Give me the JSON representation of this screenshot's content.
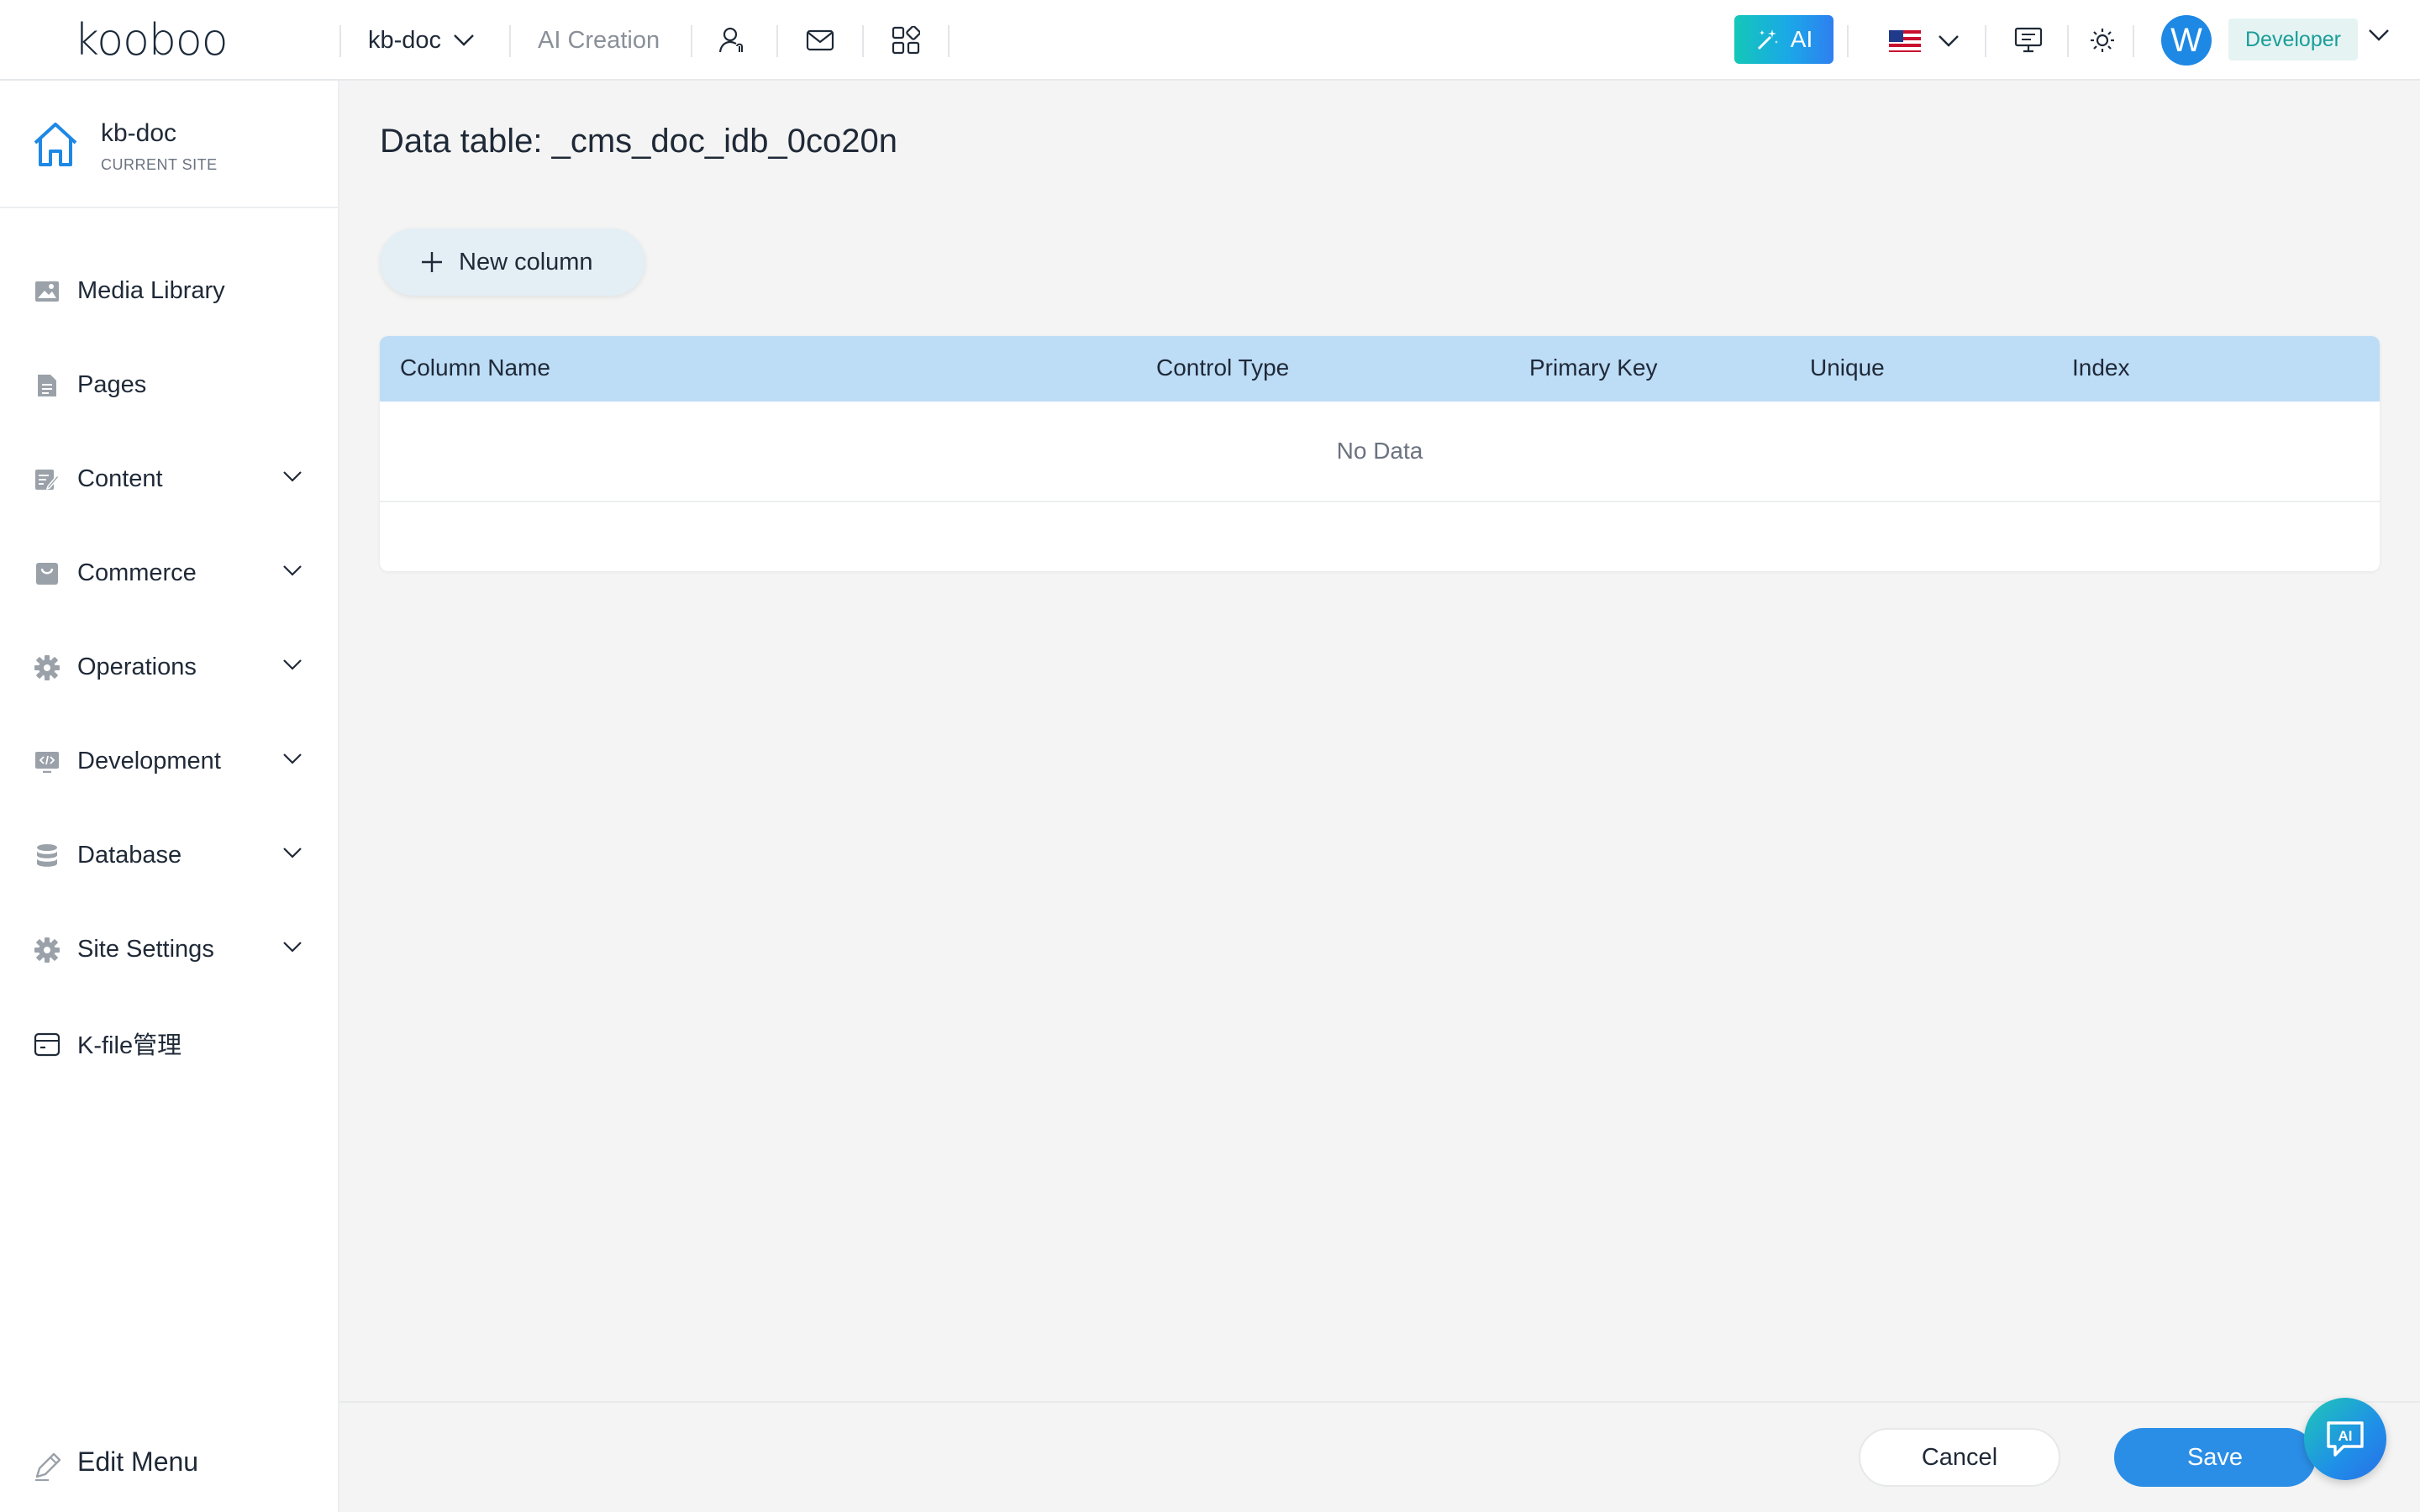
{
  "topbar": {
    "logo_text": "kooboo",
    "site_switch": "kb-doc",
    "ai_creation": "AI Creation",
    "ai_button": "AI",
    "avatar_letter": "W",
    "role": "Developer"
  },
  "sidebar": {
    "current_site": {
      "name": "kb-doc",
      "sub": "CURRENT SITE"
    },
    "items": [
      {
        "label": "Media Library",
        "icon": "image-icon",
        "expandable": false
      },
      {
        "label": "Pages",
        "icon": "page-icon",
        "expandable": false
      },
      {
        "label": "Content",
        "icon": "content-icon",
        "expandable": true
      },
      {
        "label": "Commerce",
        "icon": "commerce-icon",
        "expandable": true
      },
      {
        "label": "Operations",
        "icon": "operations-gear-icon",
        "expandable": true
      },
      {
        "label": "Development",
        "icon": "code-icon",
        "expandable": true
      },
      {
        "label": "Database",
        "icon": "database-icon",
        "expandable": true
      },
      {
        "label": "Site Settings",
        "icon": "settings-gear-icon",
        "expandable": true
      },
      {
        "label": "K-file管理",
        "icon": "folder-icon",
        "expandable": false
      }
    ],
    "edit_menu": "Edit Menu"
  },
  "main": {
    "title": "Data table: _cms_doc_idb_0co20n",
    "new_column": "New column",
    "table": {
      "headers": [
        "Column Name",
        "Control Type",
        "Primary Key",
        "Unique",
        "Index"
      ],
      "empty_text": "No Data"
    }
  },
  "footer": {
    "cancel": "Cancel",
    "save": "Save",
    "ai_float": "AI"
  },
  "colors": {
    "accent": "#2b8ee6",
    "table_header": "#bddcf6",
    "role_badge_bg": "#e5f3f3",
    "role_badge_text": "#1a9e98"
  }
}
